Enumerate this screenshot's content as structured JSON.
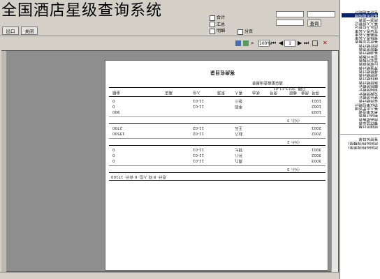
{
  "overlay": {
    "title": "全国酒店星级查询系统"
  },
  "topbar": {
    "export_label": "出口",
    "close_label": "关闭",
    "query_button": "查询",
    "checkbox_1": "合计",
    "checkbox_2": "汇总",
    "checkbox_3": "明细",
    "checkbox_4": "分页"
  },
  "toolbar": {
    "page_field": "1",
    "zoom_value": "100%",
    "icons": [
      "print-icon",
      "export-icon",
      "search-icon",
      "first-page-icon",
      "prev-page-icon",
      "next-page-icon",
      "last-page-icon",
      "close-icon"
    ]
  },
  "report": {
    "title": "客房名目录",
    "subtitle": "酒店星级查询报表",
    "date_label": "日期: 2012-11-01",
    "headers": [
      "序号",
      "房类",
      "楼层",
      "房号",
      "状态",
      "客人",
      "来源",
      "入住",
      "离店",
      "金额"
    ],
    "rows": [
      [
        "1",
        "标准",
        "1",
        "1001",
        "住",
        "张三",
        "散客",
        "11-01",
        "11-03",
        "0"
      ],
      [
        "2",
        "标准",
        "1",
        "1002",
        "住",
        "李四",
        "团队",
        "11-01",
        "11-02",
        "0"
      ],
      [
        "3",
        "豪华",
        "1",
        "1003",
        "空",
        "",
        "",
        "",
        "",
        "900"
      ],
      [
        "4",
        "标准",
        "2",
        "2001",
        "住",
        "王五",
        "散客",
        "11-02",
        "11-04",
        "2700"
      ],
      [
        "5",
        "豪华",
        "2",
        "2002",
        "住",
        "赵六",
        "协议",
        "11-02",
        "11-05",
        "13500"
      ],
      [
        "6",
        "标准",
        "3",
        "3001",
        "住",
        "钱七",
        "散客",
        "11-01",
        "11-03",
        "0"
      ],
      [
        "7",
        "标准",
        "3",
        "3002",
        "住",
        "孙八",
        "团队",
        "11-01",
        "11-02",
        "0"
      ],
      [
        "8",
        "豪华",
        "3",
        "3003",
        "住",
        "周九",
        "散客",
        "11-01",
        "11-04",
        "0"
      ]
    ],
    "subtotal_1": "小计: 3",
    "subtotal_2": "小计: 2",
    "subtotal_3": "小计: 3",
    "grand_total": "总计: 8 间   入住: 6   合计: 17100"
  },
  "sidebar": {
    "items": [
      "客房出租统计",
      "客房出租明细",
      "房态一览表",
      "客人入住登记",
      "团队入住登记",
      "在店客人名单",
      "预离客人名单",
      "预抵客人名单",
      "客房营业报表",
      "房价统计表",
      "楼层房态表",
      "客源统计表",
      "营业日报表",
      "营业月报表",
      "应收账款表",
      "押金统计表",
      "挂账统计表",
      "退房统计表",
      "续住统计表",
      "换房统计表",
      "维修房统计",
      "自用房统计",
      "免费房统计",
      "钟点房统计",
      "会员统计表",
      "协议单位统计",
      "客人历史查询",
      "黑名单查询",
      "电话计费表",
      "商品销售表",
      "餐饮营业表",
      "收银员日报"
    ],
    "selected_index": 1,
    "extra_items": [
      "客房名目录",
      "房间名称(按楼层)",
      "房间名称(按类型)"
    ]
  }
}
